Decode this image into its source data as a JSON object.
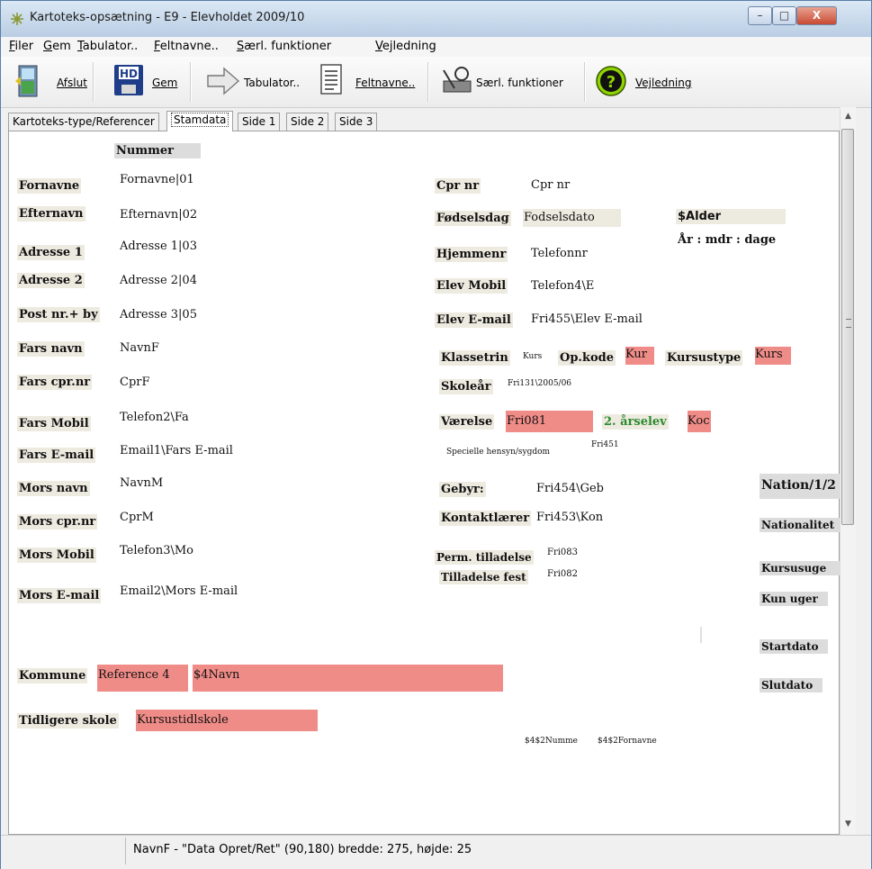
{
  "window": {
    "title": "Kartoteks-opsætning - E9 - Elevholdet 2009/10",
    "buttons": [
      "–",
      "□",
      "X"
    ]
  },
  "menu": [
    {
      "u": "F",
      "rest": "iler"
    },
    {
      "u": "G",
      "rest": "em"
    },
    {
      "u": "T",
      "rest": "abulator.."
    },
    {
      "u": "F",
      "rest": "eltnavne.."
    },
    {
      "u": "S",
      "rest": "ærl. funktioner"
    },
    {
      "u": "V",
      "rest": "ejledning"
    }
  ],
  "toolbar": {
    "afslut": "Afslut",
    "gem": "Gem",
    "tabulator": "Tabulator..",
    "feltnavne": "Feltnavne..",
    "saerl": "Særl. funktioner",
    "vejledning": "Vejledning",
    "hd_text": "HD"
  },
  "tabs": [
    "Kartoteks-type/Referencer",
    "Stamdata",
    "Side 1",
    "Side 2",
    "Side 3"
  ],
  "form": {
    "nummer": "Nummer",
    "left": [
      {
        "label": "Fornavne",
        "value": "Fornavne|01"
      },
      {
        "label": "Efternavn",
        "value": "Efternavn|02"
      },
      {
        "label": "Adresse 1",
        "value": "Adresse 1|03"
      },
      {
        "label": "Adresse 2",
        "value": "Adresse 2|04"
      },
      {
        "label": "Post nr.+ by",
        "value": "Adresse 3|05"
      },
      {
        "label": "Fars navn",
        "value": "NavnF"
      },
      {
        "label": "Fars cpr.nr",
        "value": "CprF"
      },
      {
        "label": "Fars Mobil",
        "value": "Telefon2\\Fa"
      },
      {
        "label": "Fars E-mail",
        "value": "Email1\\Fars E-mail"
      },
      {
        "label": "Mors navn",
        "value": "NavnM"
      },
      {
        "label": "Mors cpr.nr",
        "value": "CprM"
      },
      {
        "label": "Mors Mobil",
        "value": "Telefon3\\Mo"
      },
      {
        "label": "Mors E-mail",
        "value": "Email2\\Mors E-mail"
      }
    ],
    "kommune": {
      "label": "Kommune",
      "ref": "Reference 4",
      "navn": "$4Navn"
    },
    "tidligere": {
      "label": "Tidligere skole",
      "value": "Kursustidlskole"
    },
    "cpr": {
      "label": "Cpr nr",
      "value": "Cpr nr"
    },
    "fodsel": {
      "label": "Fødselsdag",
      "value": "Fodselsdato"
    },
    "alder": {
      "label": "$Alder",
      "sub": "År : mdr : dage"
    },
    "hjemmenr": {
      "label": "Hjemmenr",
      "value": "Telefonnr"
    },
    "elevmobil": {
      "label": "Elev Mobil",
      "value": "Telefon4\\E"
    },
    "elevemail": {
      "label": "Elev E-mail",
      "value": "Fri455\\Elev E-mail"
    },
    "klassetrin": {
      "label": "Klassetrin",
      "value": "Kurs"
    },
    "opkode": {
      "label": "Op.kode",
      "value": "Kur"
    },
    "kursustype": {
      "label": "Kursustype",
      "value": "Kurs"
    },
    "skoleaar": {
      "label": "Skoleår",
      "value": "Fri131\\2005/06"
    },
    "vaerelse": {
      "label": "Værelse",
      "value": "Fri081"
    },
    "aarselev": {
      "label": "2. årselev",
      "value": "Koc"
    },
    "hensyn": {
      "label": "Specielle hensyn/sygdom",
      "value": "Fri451"
    },
    "gebyr": {
      "label": "Gebyr:",
      "value": "Fri454\\Geb"
    },
    "kontakt": {
      "label": "Kontaktlærer",
      "value": "Fri453\\Kon"
    },
    "perm": {
      "label": "Perm. tilladelse",
      "value": "Fri083"
    },
    "fest": {
      "label": "Tilladelse fest",
      "value": "Fri082"
    },
    "nation": "Nation/1/2",
    "nationalitet": "Nationalitet",
    "kursusuge": "Kursusuge",
    "kunuger": "Kun uger",
    "startdato": "Startdato",
    "slutdato": "Slutdato",
    "ref_nummer": "$4$2Numme",
    "ref_fornavne": "$4$2Fornavne"
  },
  "status": "NavnF - \"Data Opret/Ret\" (90,180) bredde: 275, højde: 25"
}
